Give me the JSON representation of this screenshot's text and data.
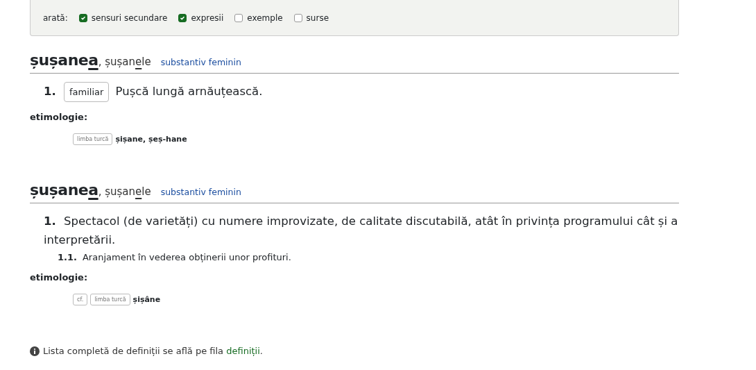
{
  "filters": {
    "label": "arată:",
    "options": [
      {
        "label": "sensuri secundare",
        "checked": true
      },
      {
        "label": "expresii",
        "checked": true
      },
      {
        "label": "exemple",
        "checked": false
      },
      {
        "label": "surse",
        "checked": false
      }
    ]
  },
  "entries": [
    {
      "headword": {
        "before": "șușane",
        "stressed": "a"
      },
      "separator": ",",
      "plural": {
        "before": "șușan",
        "stressed": "e",
        "after": "le"
      },
      "pos": "substantiv feminin",
      "senses": [
        {
          "number": "1.",
          "tags": [
            "familiar"
          ],
          "text": "Pușcă lungă arnăuțească."
        }
      ],
      "etymology": {
        "label": "etimologie:",
        "tags": [
          "limba turcă"
        ],
        "words": "șișane, șeș-hane"
      }
    },
    {
      "headword": {
        "before": "șușane",
        "stressed": "a"
      },
      "separator": ",",
      "plural": {
        "before": "șușan",
        "stressed": "e",
        "after": "le"
      },
      "pos": "substantiv feminin",
      "senses": [
        {
          "number": "1.",
          "text": "Spectacol (de varietăți) cu numere improvizate, de calitate discutabilă, atât în privința programului cât și a interpretării.",
          "children": [
            {
              "number": "1.1.",
              "text": "Aranjament în vederea obținerii unor profituri."
            }
          ]
        }
      ],
      "etymology": {
        "label": "etimologie:",
        "tags": [
          "cf.",
          "limba turcă"
        ],
        "words": "șișâne"
      }
    }
  ],
  "footer": {
    "text": "Lista completă de definiții se află pe fila ",
    "link": "definiții",
    "end": "."
  }
}
